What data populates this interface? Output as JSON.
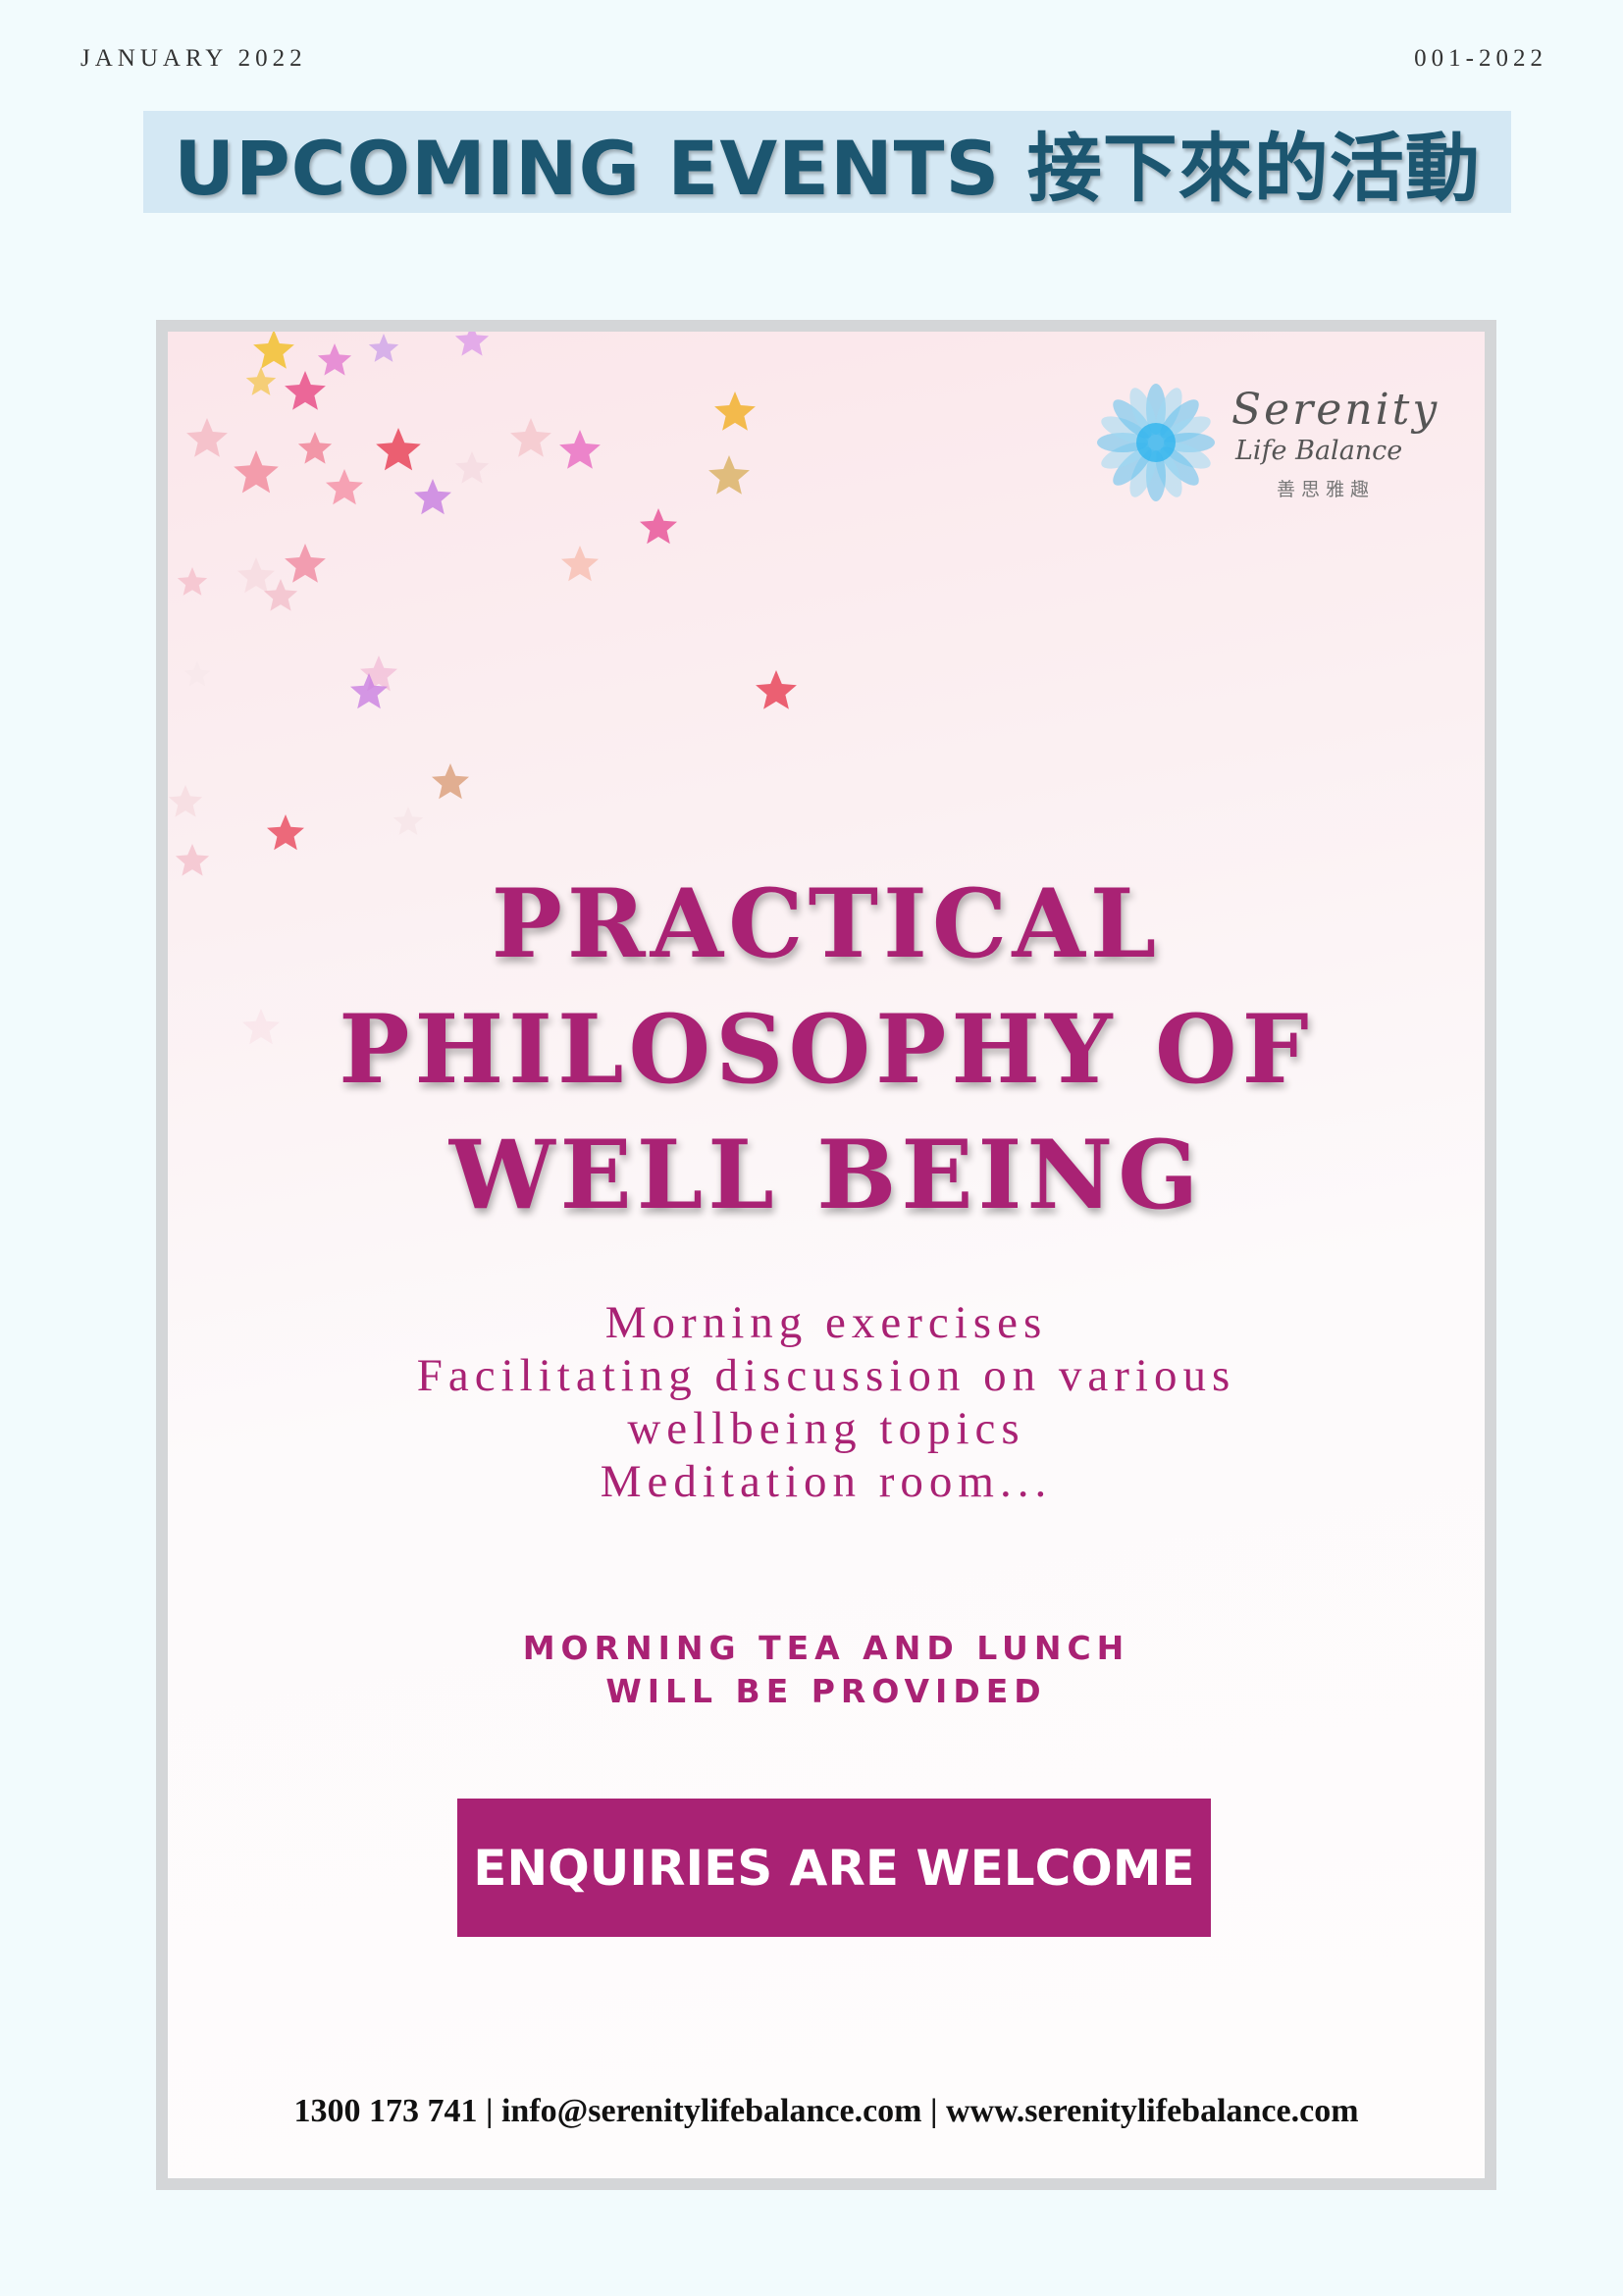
{
  "header": {
    "date": "JANUARY 2022",
    "issue": "001-2022",
    "title": "UPCOMING EVENTS 接下來的活動"
  },
  "poster": {
    "logo": {
      "name": "Serenity",
      "subtitle": "Life Balance",
      "chinese": "善思雅趣"
    },
    "headline": [
      "PRACTICAL",
      "PHILOSOPHY OF",
      "WELL BEING"
    ],
    "description": [
      "Morning exercises",
      "Facilitating discussion on various",
      "wellbeing topics",
      "Meditation room..."
    ],
    "provided": [
      "MORNING TEA AND LUNCH",
      "WILL BE PROVIDED"
    ],
    "cta_label": "ENQUIRIES ARE WELCOME",
    "contact": "1300 173 741 | info@serenitylifebalance.com | www.serenitylifebalance.com"
  },
  "colors": {
    "accent": "#a92274",
    "title": "#1c5670",
    "title_bar": "#d4e8f4",
    "page_bg": "#f2fbfd",
    "frame": "#d4d6d8"
  }
}
